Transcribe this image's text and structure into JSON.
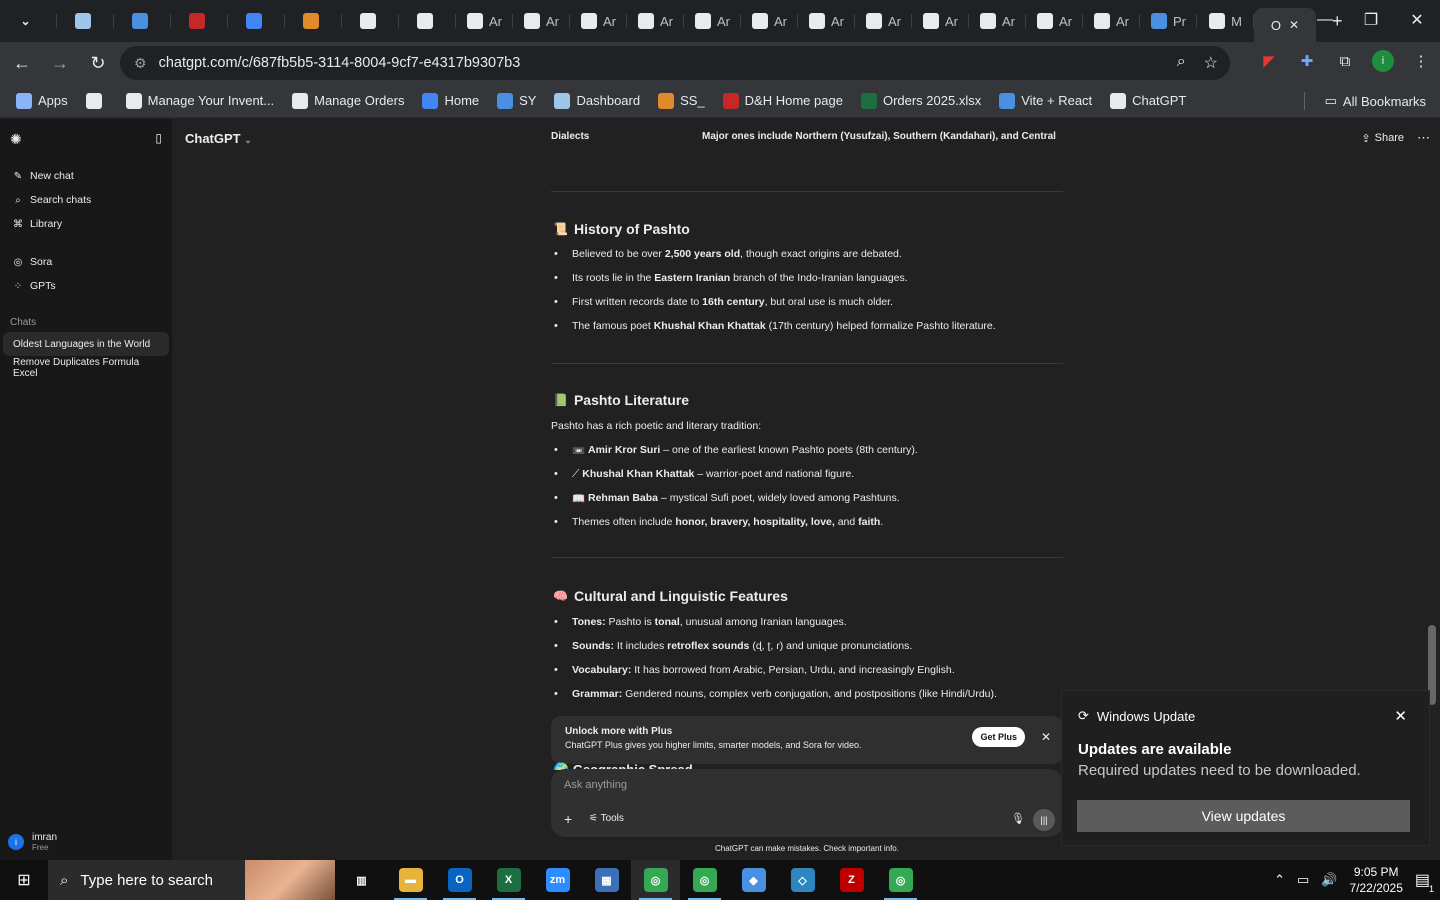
{
  "browser": {
    "tabs": [
      {
        "icon": "chevron-down-icon",
        "label": "",
        "color": "#e8eaed"
      },
      {
        "icon": "diamond-icon",
        "label": "",
        "color": "#9fc5e8"
      },
      {
        "icon": "ec-icon",
        "label": "",
        "color": "#4a90e2"
      },
      {
        "icon": "dh-icon",
        "label": "",
        "color": "#c62828"
      },
      {
        "icon": "g-icon",
        "label": "",
        "color": "#4285f4"
      },
      {
        "icon": "box-icon",
        "label": "",
        "color": "#e08a2c"
      },
      {
        "icon": "amazon-icon",
        "label": "",
        "color": "#e8eaed"
      },
      {
        "icon": "amazon-icon",
        "label": "",
        "color": "#e8eaed"
      },
      {
        "icon": "amazon-icon",
        "label": "Ar",
        "color": "#e8eaed"
      },
      {
        "icon": "amazon-icon",
        "label": "Ar",
        "color": "#e8eaed"
      },
      {
        "icon": "amazon-icon",
        "label": "Ar",
        "color": "#e8eaed"
      },
      {
        "icon": "amazon-icon",
        "label": "Ar",
        "color": "#e8eaed"
      },
      {
        "icon": "amazon-icon",
        "label": "Ar",
        "color": "#e8eaed"
      },
      {
        "icon": "amazon-icon",
        "label": "Ar",
        "color": "#e8eaed"
      },
      {
        "icon": "amazon-icon",
        "label": "Ar",
        "color": "#e8eaed"
      },
      {
        "icon": "amazon-icon",
        "label": "Ar",
        "color": "#e8eaed"
      },
      {
        "icon": "amazon-icon",
        "label": "Ar",
        "color": "#e8eaed"
      },
      {
        "icon": "amazon-icon",
        "label": "Ar",
        "color": "#e8eaed"
      },
      {
        "icon": "amazon-icon",
        "label": "Ar",
        "color": "#e8eaed"
      },
      {
        "icon": "amazon-icon",
        "label": "Ar",
        "color": "#e8eaed"
      },
      {
        "icon": "dollar-icon",
        "label": "Pr",
        "color": "#4a90e2"
      },
      {
        "icon": "amazon-icon",
        "label": "M",
        "color": "#e8eaed"
      }
    ],
    "active_tab_label": "O",
    "url": "chatgpt.com/c/687fb5b5-3114-8004-9cf7-e4317b9307b3",
    "bookmarks": [
      {
        "label": "Apps",
        "icon": "apps-grid-icon",
        "color": "#8ab4f8"
      },
      {
        "label": "",
        "icon": "tab-groups-icon",
        "color": "#e8eaed"
      },
      {
        "label": "Manage Your Invent...",
        "icon": "amazon-icon",
        "color": "#e8eaed"
      },
      {
        "label": "Manage Orders",
        "icon": "amazon-icon",
        "color": "#e8eaed"
      },
      {
        "label": "Home",
        "icon": "g-icon",
        "color": "#4285f4"
      },
      {
        "label": "SY",
        "icon": "ec-icon",
        "color": "#4a90e2"
      },
      {
        "label": "Dashboard",
        "icon": "diamond-icon",
        "color": "#9fc5e8"
      },
      {
        "label": "SS_",
        "icon": "box-icon",
        "color": "#e08a2c"
      },
      {
        "label": "D&H Home page",
        "icon": "dh-icon",
        "color": "#c62828"
      },
      {
        "label": "Orders 2025.xlsx",
        "icon": "excel-icon",
        "color": "#1d6f42"
      },
      {
        "label": "Vite + React",
        "icon": "dollar-icon",
        "color": "#4a90e2"
      },
      {
        "label": "ChatGPT",
        "icon": "openai-icon",
        "color": "#e8eaed"
      }
    ],
    "all_bookmarks": "All Bookmarks"
  },
  "sidebar": {
    "items": [
      {
        "label": "New chat",
        "icon": "compose-icon"
      },
      {
        "label": "Search chats",
        "icon": "search-icon"
      },
      {
        "label": "Library",
        "icon": "library-icon"
      }
    ],
    "items2": [
      {
        "label": "Sora",
        "icon": "sora-icon"
      },
      {
        "label": "GPTs",
        "icon": "gpts-icon"
      }
    ],
    "chats_label": "Chats",
    "chats": [
      {
        "label": "Oldest Languages in the World",
        "active": true
      },
      {
        "label": "Remove Duplicates Formula Excel",
        "active": false
      }
    ],
    "user": {
      "initial": "i",
      "name": "imran",
      "plan": "Free"
    }
  },
  "header": {
    "model": "ChatGPT",
    "share": "Share"
  },
  "content": {
    "dialect_key": "Dialects",
    "dialect_value": "Major ones include Northern (Yusufzai), Southern (Kandahari), and Central",
    "history": {
      "emoji": "📜",
      "title": "History of Pashto",
      "bullets": [
        [
          {
            "t": "Believed to be over "
          },
          {
            "t": "2,500 years old",
            "b": true
          },
          {
            "t": ", though exact origins are debated."
          }
        ],
        [
          {
            "t": "Its roots lie in the "
          },
          {
            "t": "Eastern Iranian",
            "b": true
          },
          {
            "t": " branch of the Indo-Iranian languages."
          }
        ],
        [
          {
            "t": "First written records date to "
          },
          {
            "t": "16th century",
            "b": true
          },
          {
            "t": ", but oral use is much older."
          }
        ],
        [
          {
            "t": "The famous poet "
          },
          {
            "t": "Khushal Khan Khattak",
            "b": true
          },
          {
            "t": " (17th century) helped formalize Pashto literature."
          }
        ]
      ]
    },
    "literature": {
      "emoji": "📗",
      "title": "Pashto Literature",
      "intro": "Pashto has a rich poetic and literary tradition:",
      "bullets": [
        [
          {
            "t": "📼 "
          },
          {
            "t": "Amir Kror Suri",
            "b": true
          },
          {
            "t": " – one of the earliest known Pashto poets (8th century)."
          }
        ],
        [
          {
            "t": "⟋ "
          },
          {
            "t": "Khushal Khan Khattak",
            "b": true
          },
          {
            "t": " – warrior-poet and national figure."
          }
        ],
        [
          {
            "t": "📖 "
          },
          {
            "t": "Rehman Baba",
            "b": true
          },
          {
            "t": " – mystical Sufi poet, widely loved among Pashtuns."
          }
        ],
        [
          {
            "t": "Themes often include "
          },
          {
            "t": "honor, bravery, hospitality, love,",
            "b": true
          },
          {
            "t": " and "
          },
          {
            "t": "faith",
            "b": true
          },
          {
            "t": "."
          }
        ]
      ]
    },
    "features": {
      "emoji": "🧠",
      "title": "Cultural and Linguistic Features",
      "bullets": [
        [
          {
            "t": "Tones:",
            "b": true
          },
          {
            "t": " Pashto is "
          },
          {
            "t": "tonal",
            "b": true
          },
          {
            "t": ", unusual among Iranian languages."
          }
        ],
        [
          {
            "t": "Sounds:",
            "b": true
          },
          {
            "t": " It includes "
          },
          {
            "t": "retroflex sounds",
            "b": true
          },
          {
            "t": " (ɖ, ʈ, ɾ) and unique pronunciations."
          }
        ],
        [
          {
            "t": "Vocabulary:",
            "b": true
          },
          {
            "t": " It has borrowed from Arabic, Persian, Urdu, and increasingly English."
          }
        ],
        [
          {
            "t": "Grammar:",
            "b": true
          },
          {
            "t": " Gendered nouns, complex verb conjugation, and postpositions (like Hindi/Urdu)."
          }
        ]
      ]
    },
    "peek_title": "Geographic Spread"
  },
  "upsell": {
    "title": "Unlock more with Plus",
    "subtitle": "ChatGPT Plus gives you higher limits, smarter models, and Sora for video.",
    "button": "Get Plus"
  },
  "composer": {
    "placeholder": "Ask anything",
    "tools": "Tools"
  },
  "disclaimer": "ChatGPT can make mistakes. Check important info.",
  "toast": {
    "app": "Windows Update",
    "title": "Updates are available",
    "message": "Required updates need to be downloaded.",
    "button": "View updates"
  },
  "taskbar": {
    "search_placeholder": "Type here to search",
    "apps": [
      {
        "icon": "task-view-icon",
        "glyph": "▥",
        "color": "#101010",
        "state": ""
      },
      {
        "icon": "file-explorer-icon",
        "glyph": "▬",
        "color": "#e8b33a",
        "state": "run"
      },
      {
        "icon": "outlook-icon",
        "glyph": "O",
        "color": "#0a64c2",
        "state": "run"
      },
      {
        "icon": "excel-icon",
        "glyph": "X",
        "color": "#1d6f42",
        "state": "run"
      },
      {
        "icon": "zoom-icon",
        "glyph": "zm",
        "color": "#2d8cff",
        "state": ""
      },
      {
        "icon": "calculator-icon",
        "glyph": "▦",
        "color": "#3b6fb6",
        "state": ""
      },
      {
        "icon": "chrome-icon",
        "glyph": "◎",
        "color": "#34a853",
        "state": "act run"
      },
      {
        "icon": "chrome-icon",
        "glyph": "◎",
        "color": "#34a853",
        "state": "run"
      },
      {
        "icon": "notes-icon",
        "glyph": "◆",
        "color": "#4a90e2",
        "state": ""
      },
      {
        "icon": "kite-icon",
        "glyph": "◇",
        "color": "#2e86c1",
        "state": ""
      },
      {
        "icon": "filezilla-icon",
        "glyph": "Z",
        "color": "#bf0000",
        "state": ""
      },
      {
        "icon": "chrome-profile-icon",
        "glyph": "◎",
        "color": "#34a853",
        "state": "run"
      }
    ],
    "time": "9:05 PM",
    "date": "7/22/2025",
    "notif_count": "1"
  }
}
